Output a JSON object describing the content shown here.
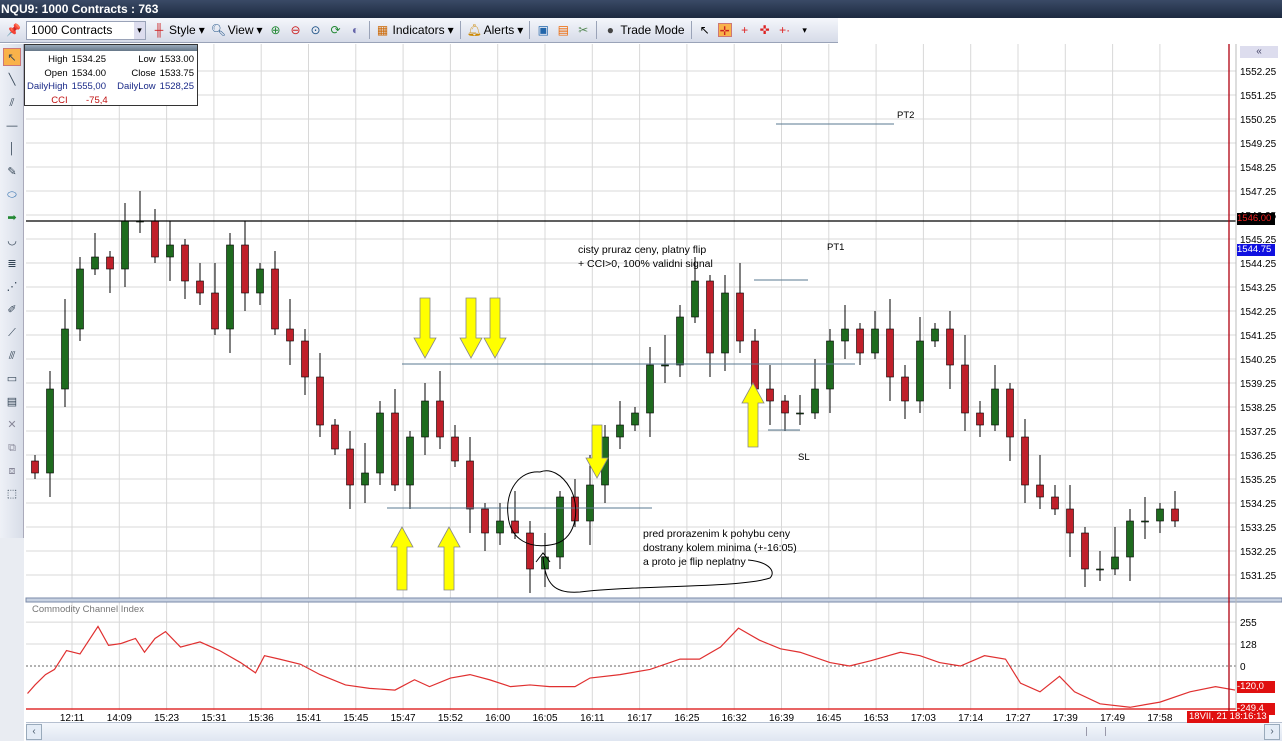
{
  "window": {
    "title": "NQU9: 1000 Contracts : 763"
  },
  "toolbar": {
    "contracts": "1000 Contracts",
    "style": "Style",
    "view": "View",
    "indicators": "Indicators",
    "alerts": "Alerts",
    "trade_mode": "Trade Mode"
  },
  "info": {
    "high_label": "High",
    "high": "1534.25",
    "low_label": "Low",
    "low": "1533.00",
    "open_label": "Open",
    "open": "1534.00",
    "close_label": "Close",
    "close": "1533.75",
    "dhigh_label": "DailyHigh",
    "dhigh": "1555,00",
    "dlow_label": "DailyLow",
    "dlow": "1528,25",
    "cci_label": "CCI",
    "cci": "-75,4"
  },
  "annotations": {
    "note1_line1": "cisty pruraz ceny, platny flip",
    "note1_line2": "+ CCI>0, 100% validni signal",
    "note2_line1": "pred prorazenim k pohybu ceny",
    "note2_line2": "dostrany kolem minima (+-16:05)",
    "note2_line3": "a proto je flip neplatny",
    "pt1": "PT1",
    "pt2": "PT2",
    "sl": "SL"
  },
  "indicator_title": "Commodity Channel Index",
  "price_markers": {
    "line": "1546.00",
    "last": "1544.75",
    "cci_current": "-120,0",
    "cci_min": "-249,4",
    "cursor_time": "18VII, 21 18:16:13"
  },
  "colors": {
    "up": "#1e6b1e",
    "down": "#c0202a",
    "cci": "#e03030",
    "grid": "#d8d8d8",
    "level": "#5a7a90",
    "arrow": "#ffff00"
  },
  "chart_data": [
    {
      "type": "candlestick",
      "title": "NQU9: 1000 Contracts",
      "y_ticks": [
        "1552.25",
        "1551.25",
        "1550.25",
        "1549.25",
        "1548.25",
        "1547.25",
        "1546.25",
        "1545.25",
        "1544.25",
        "1543.25",
        "1542.25",
        "1541.25",
        "1540.25",
        "1539.25",
        "1538.25",
        "1537.25",
        "1536.25",
        "1535.25",
        "1534.25",
        "1533.25",
        "1532.25",
        "1531.25"
      ],
      "x_ticks": [
        "12:11",
        "14:09",
        "15:23",
        "15:31",
        "15:36",
        "15:41",
        "15:45",
        "15:47",
        "15:52",
        "16:00",
        "16:05",
        "16:11",
        "16:17",
        "16:25",
        "16:32",
        "16:39",
        "16:45",
        "16:53",
        "17:03",
        "17:14",
        "17:27",
        "17:39",
        "17:49",
        "17:58"
      ],
      "ylim": [
        1530.5,
        1552.75
      ],
      "closes": [
        1535.5,
        1539,
        1541.5,
        1544,
        1544.5,
        1544,
        1546,
        1546,
        1544.5,
        1545,
        1543.5,
        1543,
        1541.5,
        1545,
        1543,
        1544,
        1541.5,
        1541,
        1539.5,
        1537.5,
        1536.5,
        1535,
        1535.5,
        1538,
        1535,
        1537,
        1538.5,
        1537,
        1536,
        1534,
        1533,
        1533.5,
        1533,
        1531.5,
        1532,
        1534.5,
        1533.5,
        1535,
        1537,
        1537.5,
        1538,
        1540,
        1540,
        1542,
        1543.5,
        1540.5,
        1543,
        1541,
        1539,
        1538.5,
        1538,
        1538,
        1539,
        1541,
        1541.5,
        1540.5,
        1541.5,
        1539.5,
        1538.5,
        1541,
        1541.5,
        1540,
        1538,
        1537.5,
        1539,
        1537,
        1535,
        1534.5,
        1534,
        1533,
        1531.5,
        1531.5,
        1532,
        1533.5,
        1533.5,
        1534,
        1533.5
      ],
      "levels": [
        1546.0,
        1539.9,
        1534.0
      ]
    },
    {
      "type": "line",
      "title": "Commodity Channel Index",
      "y_ticks": [
        "255",
        "128",
        "0"
      ],
      "ylim": [
        -249.4,
        300
      ],
      "points": [
        [
          -0.5,
          -160
        ],
        [
          0,
          -110
        ],
        [
          0.7,
          -50
        ],
        [
          1.3,
          -20
        ],
        [
          2.1,
          90
        ],
        [
          3,
          70
        ],
        [
          4.2,
          230
        ],
        [
          4.9,
          120
        ],
        [
          5.7,
          130
        ],
        [
          6.7,
          160
        ],
        [
          7.3,
          80
        ],
        [
          8,
          160
        ],
        [
          8.7,
          200
        ],
        [
          9.7,
          110
        ],
        [
          11,
          140
        ],
        [
          12.3,
          90
        ],
        [
          13.7,
          20
        ],
        [
          14.7,
          -40
        ],
        [
          15.3,
          60
        ],
        [
          16.3,
          40
        ],
        [
          17.7,
          10
        ],
        [
          19,
          -50
        ],
        [
          20.7,
          -110
        ],
        [
          22.3,
          -130
        ],
        [
          24,
          -140
        ],
        [
          25.3,
          -80
        ],
        [
          26.3,
          -120
        ],
        [
          27.7,
          -70
        ],
        [
          29,
          -50
        ],
        [
          30.3,
          -80
        ],
        [
          31.7,
          -120
        ],
        [
          33,
          -110
        ],
        [
          34.3,
          -120
        ],
        [
          36,
          -120
        ],
        [
          37,
          -70
        ],
        [
          39,
          -50
        ],
        [
          41,
          -20
        ],
        [
          43,
          40
        ],
        [
          44.3,
          40
        ],
        [
          45.7,
          110
        ],
        [
          46.9,
          220
        ],
        [
          48.3,
          150
        ],
        [
          49.7,
          100
        ],
        [
          51,
          80
        ],
        [
          53,
          20
        ],
        [
          54.3,
          0
        ],
        [
          55.7,
          30
        ],
        [
          57.7,
          80
        ],
        [
          59,
          60
        ],
        [
          60.3,
          20
        ],
        [
          61.7,
          0
        ],
        [
          63.3,
          60
        ],
        [
          64.7,
          40
        ],
        [
          65.7,
          -100
        ],
        [
          67,
          -150
        ],
        [
          68.3,
          -60
        ],
        [
          69.3,
          -150
        ],
        [
          71,
          -220
        ],
        [
          73,
          -240
        ],
        [
          75,
          -210
        ],
        [
          77,
          -150
        ],
        [
          78.7,
          -120
        ],
        [
          80,
          -140
        ]
      ]
    }
  ]
}
